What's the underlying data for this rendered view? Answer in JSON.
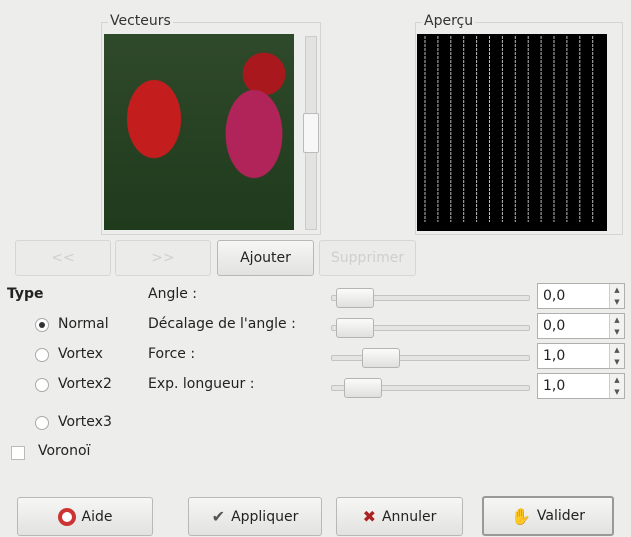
{
  "vectors": {
    "label": "Vecteurs"
  },
  "preview": {
    "label": "Aperçu",
    "line_count": 14
  },
  "vector_buttons": {
    "prev": "<<",
    "next": ">>",
    "add": "Ajouter",
    "delete": "Supprimer"
  },
  "type": {
    "label": "Type",
    "options": [
      "Normal",
      "Vortex",
      "Vortex2",
      "Vortex3"
    ],
    "selected": "Normal"
  },
  "voronoi": {
    "label": "Voronoï",
    "checked": false
  },
  "params": [
    {
      "label": "Angle :",
      "value": "0,0"
    },
    {
      "label": "Décalage de l'angle :",
      "value": "0,0"
    },
    {
      "label": "Force :",
      "value": "1,0"
    },
    {
      "label": "Exp. longueur :",
      "value": "1,0"
    }
  ],
  "footer": {
    "help": "Aide",
    "apply": "Appliquer",
    "cancel": "Annuler",
    "ok": "Valider"
  }
}
